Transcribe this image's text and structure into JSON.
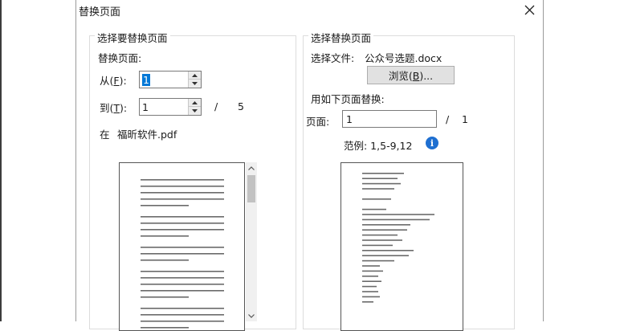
{
  "dialog": {
    "title": "替换页面",
    "close_glyph": "✕"
  },
  "left_group": {
    "legend": "选择要替换页面",
    "section_label": "替换页面:",
    "from_label": "从(F):",
    "from_value": "1",
    "to_label": "到(T):",
    "to_value": "1",
    "separator": "/",
    "total_pages": "5",
    "file_prefix": "在",
    "file_name": "福昕软件.pdf"
  },
  "right_group": {
    "legend": "选择替换页面",
    "file_label": "选择文件:",
    "file_name": "公众号选题.docx",
    "browse_button": "浏览(B)...",
    "replace_with_label": "用如下页面替换:",
    "page_label": "页面:",
    "page_value": "1",
    "separator": "/",
    "total_pages": "1",
    "example_text": "范例: 1,5-9,12"
  },
  "icons": {
    "close": "close-icon",
    "info": "info-icon",
    "spin_up": "chevron-up-icon",
    "spin_down": "chevron-down-icon"
  },
  "colors": {
    "selection": "#0078d7",
    "info": "#1e6fd1"
  }
}
